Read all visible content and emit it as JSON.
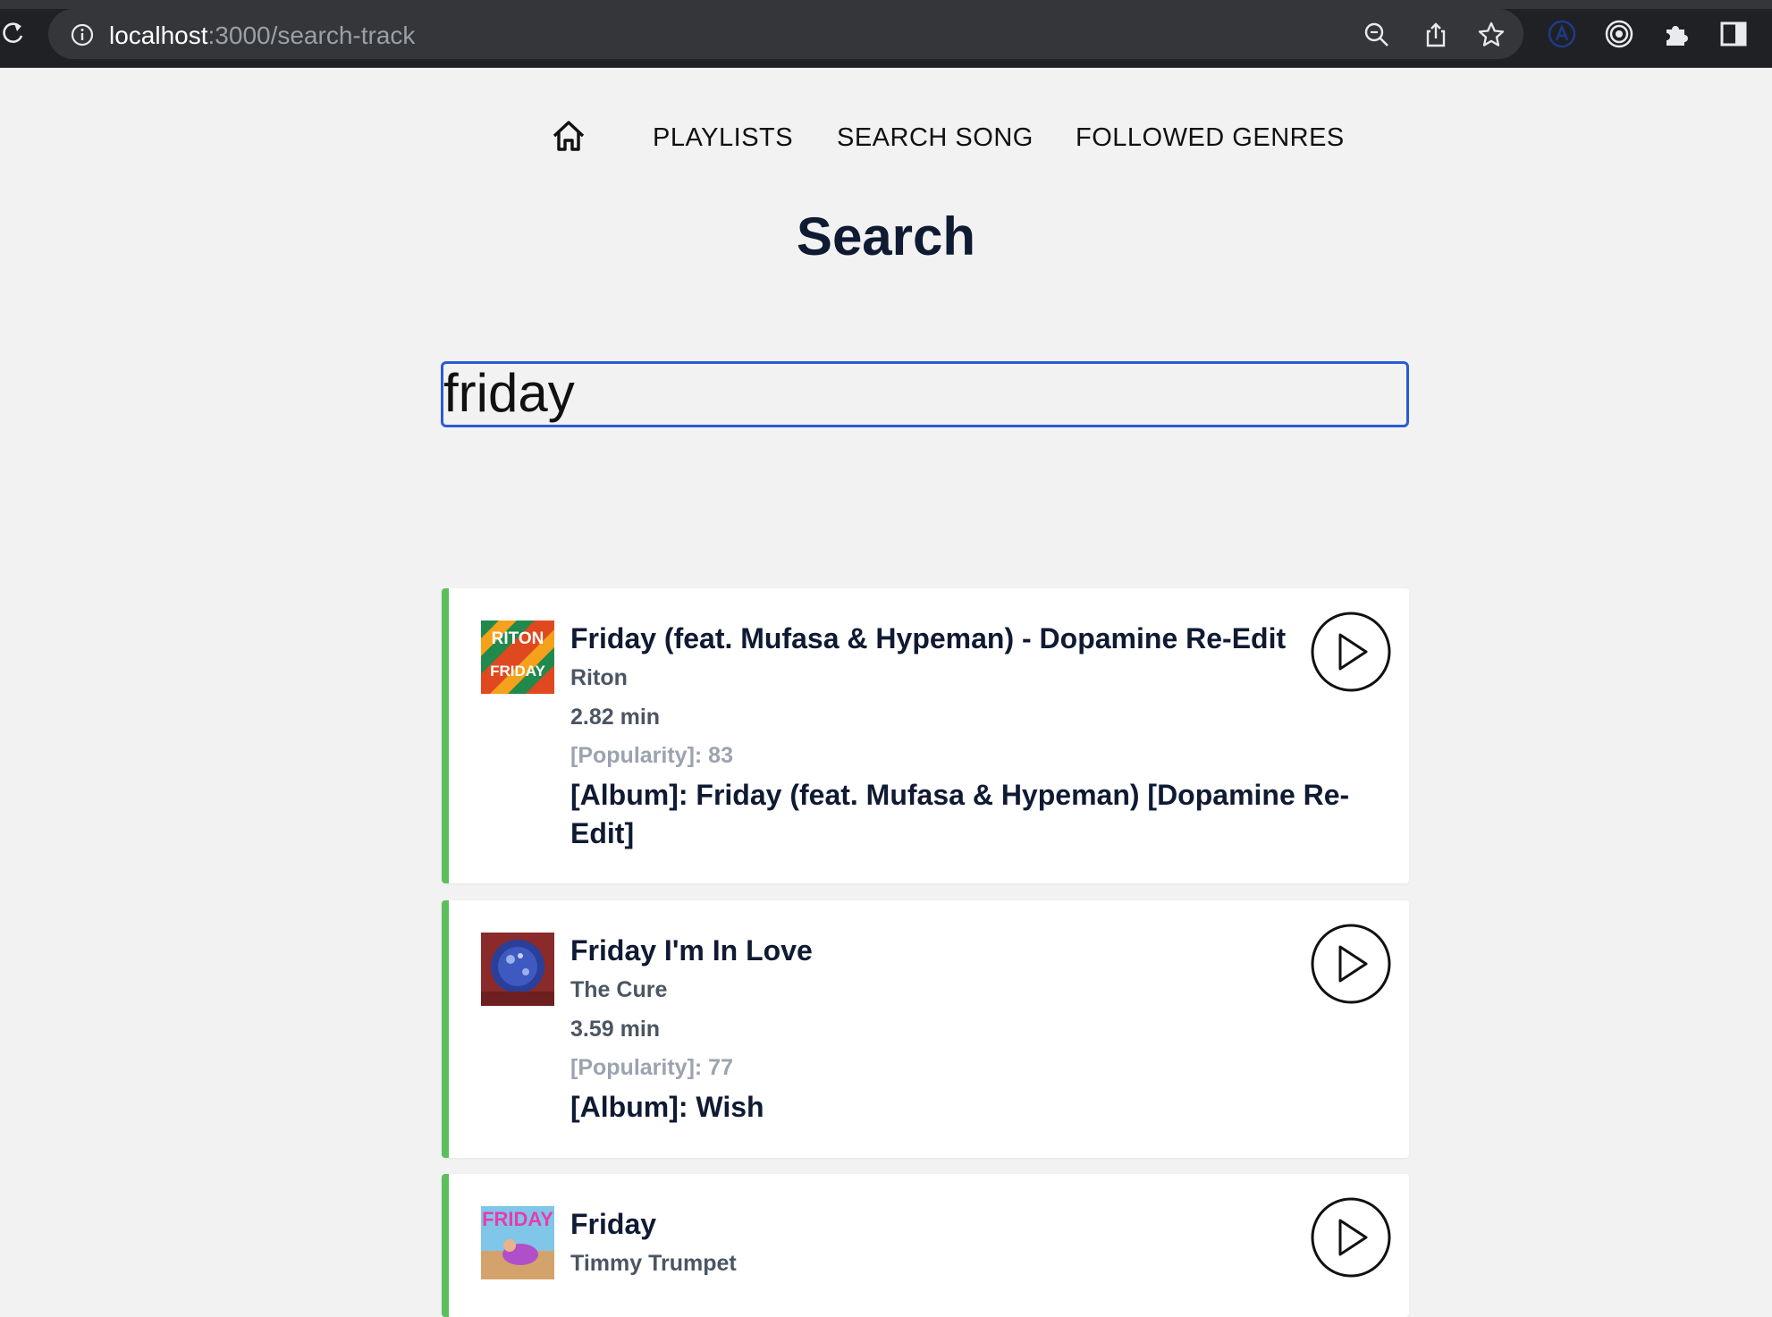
{
  "browser": {
    "url_host": "localhost",
    "url_path": ":3000/search-track"
  },
  "nav": {
    "items": [
      {
        "label": "PLAYLISTS"
      },
      {
        "label": "SEARCH SONG"
      },
      {
        "label": "FOLLOWED GENRES"
      }
    ]
  },
  "page": {
    "title": "Search"
  },
  "search": {
    "value": "friday"
  },
  "colors": {
    "accent_border": "#5bbf5b",
    "input_focus": "#2a5bd7",
    "title": "#0f1a33"
  },
  "tracks": [
    {
      "title": "Friday (feat. Mufasa & Hypeman) - Dopamine Re-Edit",
      "artist": "Riton",
      "duration": "2.82 min",
      "popularity": "[Popularity]: 83",
      "album": "[Album]: Friday (feat. Mufasa & Hypeman) [Dopamine Re-Edit]",
      "cover_text_top": "RITON",
      "cover_text_bottom": "FRIDAY"
    },
    {
      "title": "Friday I'm In Love",
      "artist": "The Cure",
      "duration": "3.59 min",
      "popularity": "[Popularity]: 77",
      "album": "[Album]: Wish"
    },
    {
      "title": "Friday",
      "artist": "Timmy Trumpet",
      "cover_text_top": "FRIDAY"
    }
  ]
}
